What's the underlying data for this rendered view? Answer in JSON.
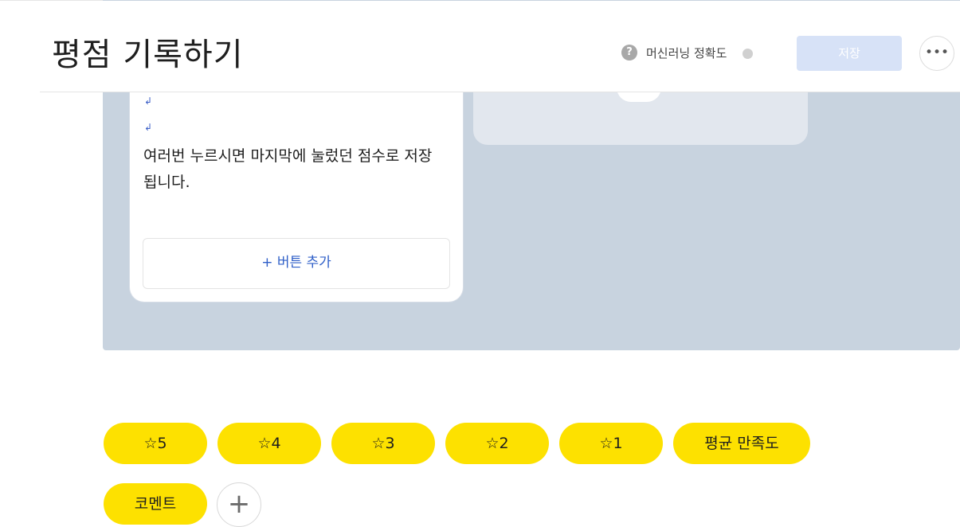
{
  "header": {
    "title": "평점 기록하기",
    "help_icon": "?",
    "ml_label": "머신러닝 정확도",
    "save_label": "저장",
    "more_label": "•••"
  },
  "card": {
    "return_mark": "↲",
    "text": "여러번 누르시면 마지막에 눌렀던 점수로 저장됩니다.",
    "add_button_label": "+ 버튼 추가"
  },
  "quick_replies": [
    {
      "label": "☆5"
    },
    {
      "label": "☆4"
    },
    {
      "label": "☆3"
    },
    {
      "label": "☆2"
    },
    {
      "label": "☆1"
    },
    {
      "label": "평균 만족도"
    },
    {
      "label": "코멘트"
    }
  ],
  "add_reply_label": "+",
  "colors": {
    "chip": "#fde100",
    "canvas": "#c8d3df",
    "save_button": "#d7e2f7",
    "link": "#2f5fc8"
  },
  "icons": {
    "help": "question-circle-icon",
    "status_dot": "status-dot-icon",
    "more": "ellipsis-icon",
    "add": "plus-icon"
  }
}
